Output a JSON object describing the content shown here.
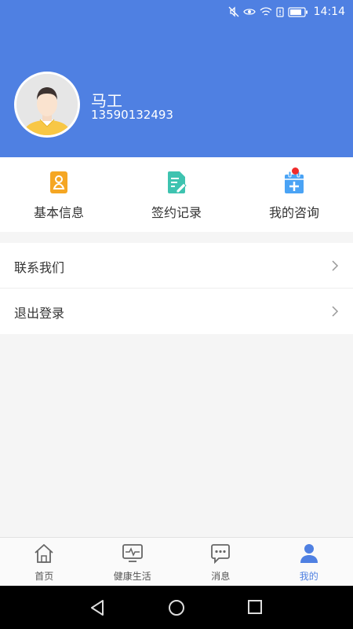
{
  "statusbar": {
    "time": "14:14"
  },
  "profile": {
    "name": "马工",
    "phone": "13590132493"
  },
  "quick_actions": [
    {
      "label": "基本信息",
      "icon": "id-card-icon",
      "color": "#f5a623"
    },
    {
      "label": "签约记录",
      "icon": "document-edit-icon",
      "color": "#3ec3b0"
    },
    {
      "label": "我的咨询",
      "icon": "calendar-plus-icon",
      "color": "#4aa3f5",
      "has_badge": true
    }
  ],
  "menu": [
    {
      "label": "联系我们"
    },
    {
      "label": "退出登录"
    }
  ],
  "tabbar": [
    {
      "label": "首页",
      "icon": "home-icon",
      "active": false
    },
    {
      "label": "健康生活",
      "icon": "monitor-pulse-icon",
      "active": false
    },
    {
      "label": "消息",
      "icon": "chat-icon",
      "active": false
    },
    {
      "label": "我的",
      "icon": "user-icon",
      "active": true
    }
  ],
  "colors": {
    "primary": "#4f80e2",
    "badge": "#f02b2b"
  }
}
